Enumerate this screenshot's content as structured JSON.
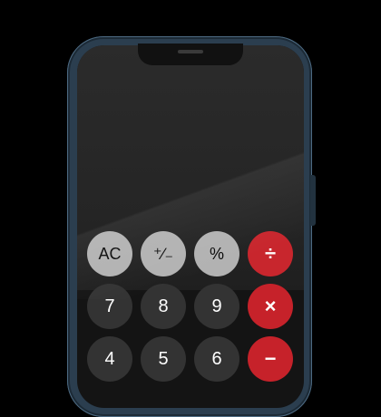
{
  "calculator": {
    "display_value": "",
    "keys": {
      "ac": "AC",
      "plus_minus": "⁺∕₋",
      "percent": "%",
      "divide": "÷",
      "seven": "7",
      "eight": "8",
      "nine": "9",
      "multiply": "×",
      "four": "4",
      "five": "5",
      "six": "6",
      "minus": "−"
    }
  },
  "colors": {
    "function_key": "#a6a6a6",
    "number_key": "#333333",
    "operator_key": "#c6222a",
    "phone_frame": "#2b3e4f"
  }
}
